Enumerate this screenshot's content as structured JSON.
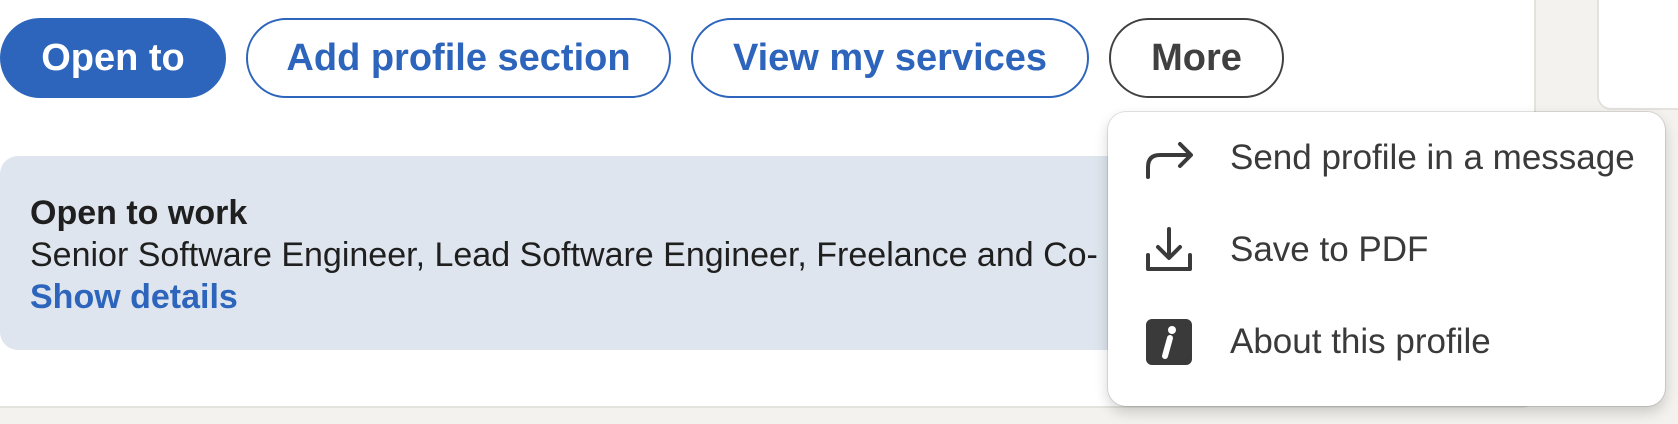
{
  "actions": {
    "open_to_label": "Open to",
    "add_section_label": "Add profile section",
    "view_services_label": "View my services",
    "more_label": "More"
  },
  "open_to_work": {
    "title": "Open to work",
    "roles": "Senior Software Engineer, Lead Software Engineer, Freelance and Co-",
    "link_label": "Show details"
  },
  "more_menu": {
    "items": [
      {
        "label": "Send profile in a message",
        "icon": "share-arrow-icon"
      },
      {
        "label": "Save to PDF",
        "icon": "download-icon"
      },
      {
        "label": "About this profile",
        "icon": "info-icon"
      }
    ]
  },
  "colors": {
    "brand_blue": "#2d64bc",
    "banner_bg": "#dee5ee",
    "page_bg": "#f4f2ee"
  }
}
